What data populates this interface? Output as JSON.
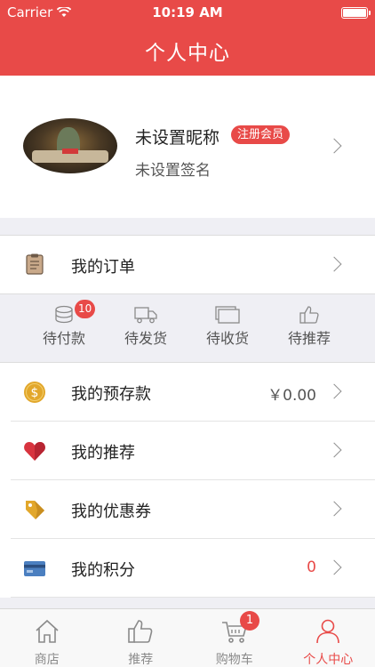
{
  "status_bar": {
    "carrier": "Carrier",
    "time": "10:19 AM",
    "battery_level": 1.0
  },
  "nav": {
    "title": "个人中心"
  },
  "profile": {
    "nickname": "未设置昵称",
    "member_badge": "注册会员",
    "signature": "未设置签名"
  },
  "menu": {
    "orders": {
      "label": "我的订单",
      "icon": "clipboard-icon"
    },
    "deposit": {
      "label": "我的预存款",
      "value": "￥0.00",
      "icon": "coin-icon"
    },
    "recommend": {
      "label": "我的推荐",
      "icon": "heart-icon"
    },
    "coupons": {
      "label": "我的优惠券",
      "icon": "tag-icon"
    },
    "points": {
      "label": "我的积分",
      "value": "0",
      "icon": "card-icon"
    }
  },
  "order_states": [
    {
      "label": "待付款",
      "count": "10",
      "icon": "coins-stack-icon"
    },
    {
      "label": "待发货",
      "icon": "truck-icon"
    },
    {
      "label": "待收货",
      "icon": "package-icon"
    },
    {
      "label": "待推荐",
      "icon": "thumb-up-icon"
    }
  ],
  "tabbar": {
    "items": [
      {
        "label": "商店",
        "icon": "home-icon"
      },
      {
        "label": "推荐",
        "icon": "thumb-up-icon"
      },
      {
        "label": "购物车",
        "icon": "cart-icon",
        "count": "1"
      },
      {
        "label": "个人中心",
        "icon": "person-icon"
      }
    ],
    "active_index": 3
  },
  "colors": {
    "brand": "#e84a48",
    "coin": "#e2a72b",
    "heart": "#d8343f",
    "tag": "#e2a72b",
    "card": "#4b7fc0"
  }
}
